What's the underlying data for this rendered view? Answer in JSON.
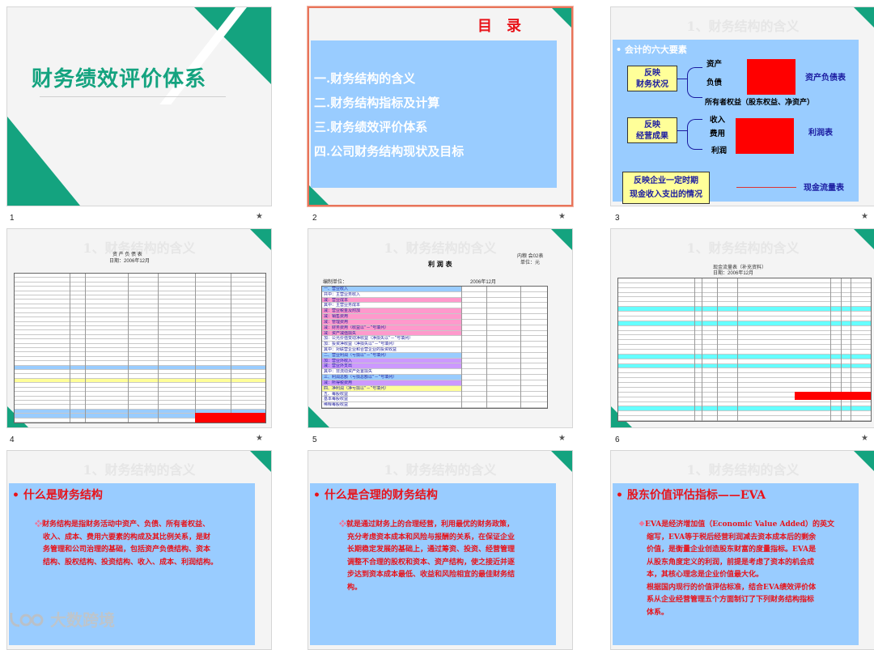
{
  "slides": [
    {
      "num": "1",
      "title": "财务绩效评价体系"
    },
    {
      "num": "2",
      "heading": "目　录",
      "items": [
        "一.财务结构的含义",
        "二.财务结构指标及计算",
        "三.财务绩效评价体系",
        "四.公司财务结构现状及目标"
      ]
    },
    {
      "num": "3",
      "ghost": "1、财务结构的含义",
      "bullet": "会计的六大要素",
      "box1": "反映\n财务状况",
      "box1_l1": "反映",
      "box1_l2": "财务状况",
      "box1_items": [
        "资产",
        "负债",
        "所有者权益（股东权益、净资产）"
      ],
      "box1_right": "资产负债表",
      "box2_l1": "反映",
      "box2_l2": "经营成果",
      "box2_items": [
        "收入",
        "费用",
        "利润"
      ],
      "box2_right": "利润表",
      "box3_l1": "反映企业一定时期",
      "box3_l2": "现金收入支出的情况",
      "box3_right": "现金流量表"
    },
    {
      "num": "4",
      "ghost": "1、财务结构的含义",
      "table_title": "资 产 负 债 表",
      "table_sub": "日期：2006年12月"
    },
    {
      "num": "5",
      "ghost": "1、财务结构的含义",
      "table_title": "利 润 表",
      "date": "2006年12月",
      "code": "内粮 会02表",
      "unit": "单位：元",
      "org": "编制单位：",
      "rows": [
        "一、营业收入",
        "共中：主营业务收入",
        "减：营业成本",
        "其中：主营业务成本",
        "减：营业税金及附加",
        "减：销售费用",
        "减：管理费用",
        "减：财务费用（收益以“－”号填列）",
        "减：资产减值损失",
        "加：公允价值变动净收益（净损失以“－”号填列）",
        "加：投资净收益（净损失以“－”号填列）",
        "其中：对联营企业和合营企业的投资收益",
        "二、营业利润（亏损以“－”号填列）",
        "加：营业外收入",
        "减：营业外支出",
        "其中：非流动资产处置损失",
        "三、利润总额（亏损总额以“－”号填列）",
        "减：所得税费用",
        "四、净利润（净亏损以“－”号填列）",
        "五、每股收益",
        "基本每股收益",
        "稀释每股收益"
      ]
    },
    {
      "num": "6",
      "ghost": "1、财务结构的含义",
      "table_title": "现金流量表（补充资料）",
      "table_sub": "日期：2006年12月"
    },
    {
      "num": "7",
      "ghost": "1、财务结构的含义",
      "heading": "什么是财务结构",
      "lines": [
        "财务结构是指财务活动中资产、负债、所有者权益、",
        "收入、成本、费用六要素的构成及其比例关系，是财",
        "务管理和公司治理的基础，包括资产负债结构、资本",
        "结构、股权结构、投资结构、收入、成本、利润结构。"
      ]
    },
    {
      "num": "8",
      "ghost": "1、财务结构的含义",
      "heading": "什么是合理的财务结构",
      "lines": [
        "就是通过财务上的合理经营，利用最优的财务政策，",
        "充分考虑资本成本和风险与报酬的关系，在保证企业",
        "长期稳定发展的基础上，通过筹资、投资、经营管理",
        "调整不合理的股权和资本、资产结构，使之接近并逐",
        "步达到资本成本最低、收益和风险相宜的最佳财务结",
        "构。"
      ]
    },
    {
      "num": "9",
      "ghost": "1、财务结构的含义",
      "heading": "股东价值评估指标——EVA",
      "lines": [
        "EVA是经济增加值（Economic Value Added）的英文",
        "缩写，EVA等于税后经营利润减去资本成本后的剩余",
        "价值，是衡量企业创造股东财富的度量指标。EVA是",
        "从股东角度定义的利润，前提是考虑了资本的机会成",
        "本，其核心理念是企业价值最大化。",
        "根据国内现行的价值评估标准，结合EVA绩效评价体",
        "系从企业经营管理五个方面制订了下列财务结构指标",
        "体系。"
      ]
    }
  ],
  "watermark": "大数跨境",
  "colors": {
    "green": "#14a37f",
    "blue_box": "#99ccff",
    "red_text": "#e8131a",
    "selected_border": "#e8745a"
  }
}
